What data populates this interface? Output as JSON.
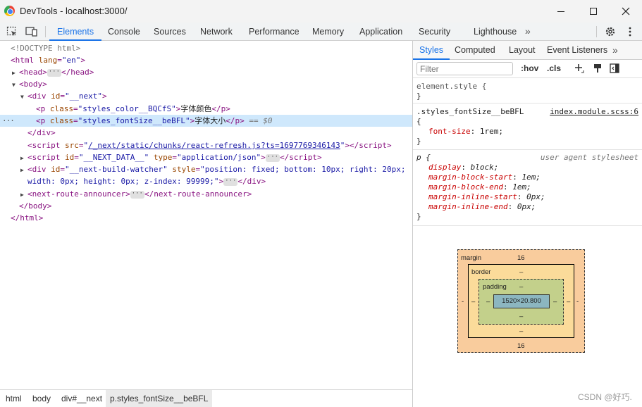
{
  "window": {
    "title": "DevTools - localhost:3000/",
    "controls": [
      "minimize",
      "maximize",
      "close"
    ]
  },
  "main_tabs": [
    {
      "label": "Elements",
      "active": true
    },
    {
      "label": "Console"
    },
    {
      "label": "Sources"
    },
    {
      "label": "Network"
    },
    {
      "label": "Performance"
    },
    {
      "label": "Memory"
    },
    {
      "label": "Application"
    },
    {
      "label": "Security"
    },
    {
      "label": "Lighthouse"
    }
  ],
  "main_tabs_overflow": "»",
  "icons": {
    "inspect": "inspect-element-icon",
    "device": "device-toolbar-icon",
    "settings": "gear-icon",
    "more": "kebab-menu-icon"
  },
  "dom": {
    "doctype": "<!DOCTYPE html>",
    "html_open": {
      "tag": "html",
      "attr": "lang",
      "val": "\"en\""
    },
    "head": {
      "open": "<head>",
      "close": "</head>"
    },
    "body_open": "<body>",
    "div_next": {
      "tag": "div",
      "attr": "id",
      "val": "\"__next\""
    },
    "p1": {
      "attr": "class",
      "val": "\"styles_color__BQCfS\"",
      "text": "字体颜色"
    },
    "p2": {
      "attr": "class",
      "val": "\"styles_fontSize__beBFL\"",
      "text": "字体大小",
      "marker": "== $0"
    },
    "div_close": "</div>",
    "script1": {
      "attr": "src",
      "val": "/_next/static/chunks/react-refresh.js?ts=1697769346143"
    },
    "script2": {
      "attr1": "id",
      "val1": "\"__NEXT_DATA__\"",
      "attr2": "type",
      "val2": "\"application/json\""
    },
    "div_watcher": {
      "attr1": "id",
      "val1": "\"__next-build-watcher\"",
      "attr2": "style",
      "val2_line1": "\"position: fixed; bottom: 10px; right: 20px;",
      "val2_line2": "width: 0px; height: 0px; z-index: 99999;\""
    },
    "announcer": {
      "tag": "next-route-announcer"
    },
    "body_close": "</body>",
    "html_close": "</html>"
  },
  "breadcrumbs": [
    "html",
    "body",
    "div#__next",
    "p.styles_fontSize__beBFL"
  ],
  "side_tabs": [
    {
      "label": "Styles",
      "active": true
    },
    {
      "label": "Computed"
    },
    {
      "label": "Layout"
    },
    {
      "label": "Event Listeners"
    }
  ],
  "side_tabs_overflow": "»",
  "filter": {
    "placeholder": "Filter",
    "hov": ":hov",
    "cls": ".cls"
  },
  "rules": {
    "element_style": {
      "selector": "element.style {",
      "close": "}"
    },
    "font_size_rule": {
      "selector": ".styles_fontSize__beBFL",
      "source": "index.module.scss:6",
      "open": "{",
      "prop": "font-size",
      "value": "1rem;",
      "close": "}"
    },
    "ua_rule": {
      "selector": "p {",
      "source": "user agent stylesheet",
      "props": [
        {
          "name": "display",
          "value": "block;"
        },
        {
          "name": "margin-block-start",
          "value": "1em;"
        },
        {
          "name": "margin-block-end",
          "value": "1em;"
        },
        {
          "name": "margin-inline-start",
          "value": "0px;"
        },
        {
          "name": "margin-inline-end",
          "value": "0px;"
        }
      ],
      "close": "}"
    }
  },
  "box_model": {
    "margin_label": "margin",
    "margin_top": "16",
    "margin_bottom": "16",
    "margin_left": "-",
    "margin_right": "-",
    "border_label": "border",
    "border_top": "–",
    "border_bottom": "–",
    "border_left": "–",
    "border_right": "–",
    "padding_label": "padding",
    "padding_top": "–",
    "padding_bottom": "–",
    "padding_left": "–",
    "padding_right": "–",
    "content": "1520×20.800"
  },
  "watermark": "CSDN @好巧."
}
